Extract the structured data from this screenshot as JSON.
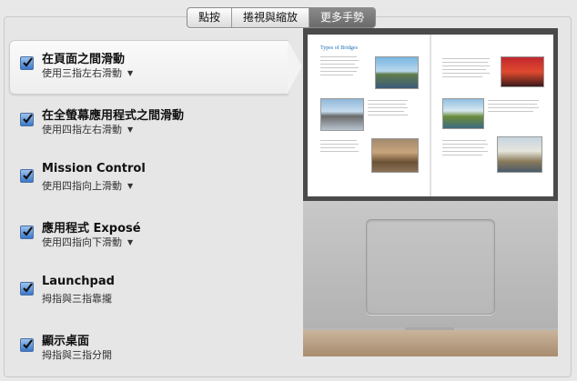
{
  "tabs": [
    {
      "label": "點按",
      "active": false
    },
    {
      "label": "捲視與縮放",
      "active": false
    },
    {
      "label": "更多手勢",
      "active": true
    }
  ],
  "gestures": [
    {
      "title": "在頁面之間滑動",
      "subtitle": "使用三指左右滑動",
      "checked": true,
      "has_menu": true,
      "selected": true
    },
    {
      "title": "在全螢幕應用程式之間滑動",
      "subtitle": "使用四指左右滑動",
      "checked": true,
      "has_menu": true,
      "selected": false
    },
    {
      "title": "Mission Control",
      "subtitle": "使用四指向上滑動",
      "checked": true,
      "has_menu": true,
      "selected": false
    },
    {
      "title": "應用程式 Exposé",
      "subtitle": "使用四指向下滑動",
      "checked": true,
      "has_menu": true,
      "selected": false
    },
    {
      "title": "Launchpad",
      "subtitle": "拇指與三指靠攏",
      "checked": true,
      "has_menu": false,
      "selected": false
    },
    {
      "title": "顯示桌面",
      "subtitle": "拇指與三指分開",
      "checked": true,
      "has_menu": false,
      "selected": false
    }
  ],
  "preview": {
    "page_heading": "Types of Bridges"
  },
  "colors": {
    "accent": "#3b78c9",
    "tab_active": "#7a7a7a",
    "background": "#e8e8e8"
  },
  "icons": {
    "checkmark": "checkmark-icon",
    "caret": "caret-down-icon"
  }
}
